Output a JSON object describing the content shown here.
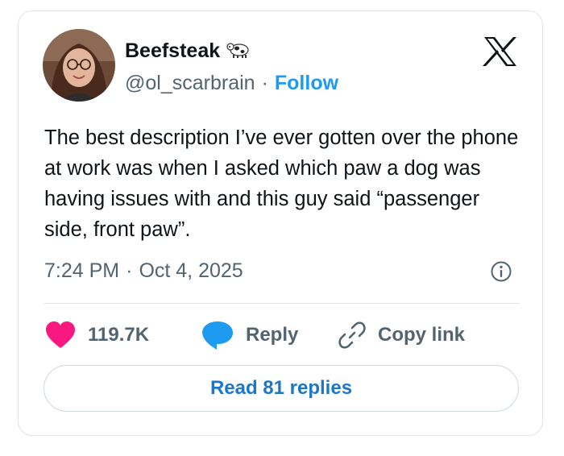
{
  "author": {
    "display_name": "Beefsteak",
    "handle": "@ol_scarbrain",
    "separator": "·",
    "follow_label": "Follow",
    "name_icon": "cow-icon"
  },
  "tweet": {
    "text": "The best description I’ve ever gotten over the phone at work was when I asked which paw a dog was having issues with and this guy said “passenger side, front paw”.",
    "time": "7:24 PM",
    "separator": "·",
    "date": "Oct 4, 2025"
  },
  "actions": {
    "like_count": "119.7K",
    "reply_label": "Reply",
    "copy_link_label": "Copy link"
  },
  "read_replies_label": "Read 81 replies",
  "colors": {
    "like": "#f91880",
    "reply": "#1d9bf0",
    "follow": "#1d9bf0",
    "read_replies": "#1d77c9",
    "secondary_text": "#536471"
  }
}
